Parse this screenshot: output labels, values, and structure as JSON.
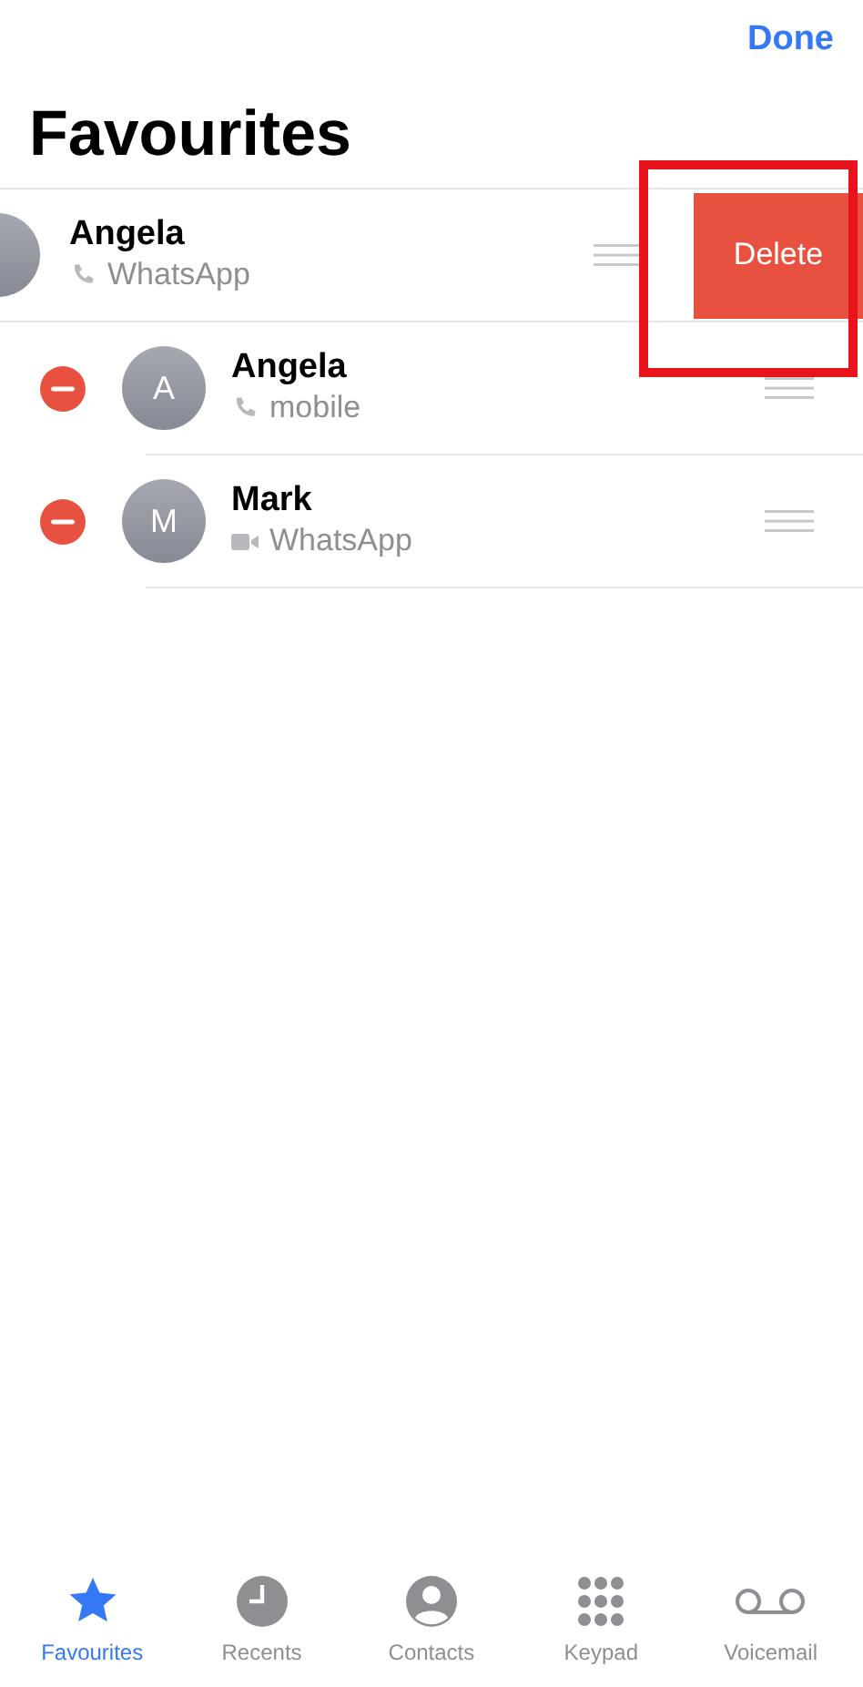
{
  "nav": {
    "done": "Done"
  },
  "title": "Favourites",
  "favourites": [
    {
      "kind": "swiped",
      "name": "Angela",
      "via": "WhatsApp",
      "action": "Delete"
    },
    {
      "kind": "editing",
      "initial": "A",
      "name": "Angela",
      "via": "mobile"
    },
    {
      "kind": "editing",
      "initial": "M",
      "name": "Mark",
      "via": "WhatsApp"
    }
  ],
  "tabs": [
    {
      "label": "Favourites",
      "selected": true
    },
    {
      "label": "Recents",
      "selected": false
    },
    {
      "label": "Contacts",
      "selected": false
    },
    {
      "label": "Keypad",
      "selected": false
    },
    {
      "label": "Voicemail",
      "selected": false
    }
  ]
}
